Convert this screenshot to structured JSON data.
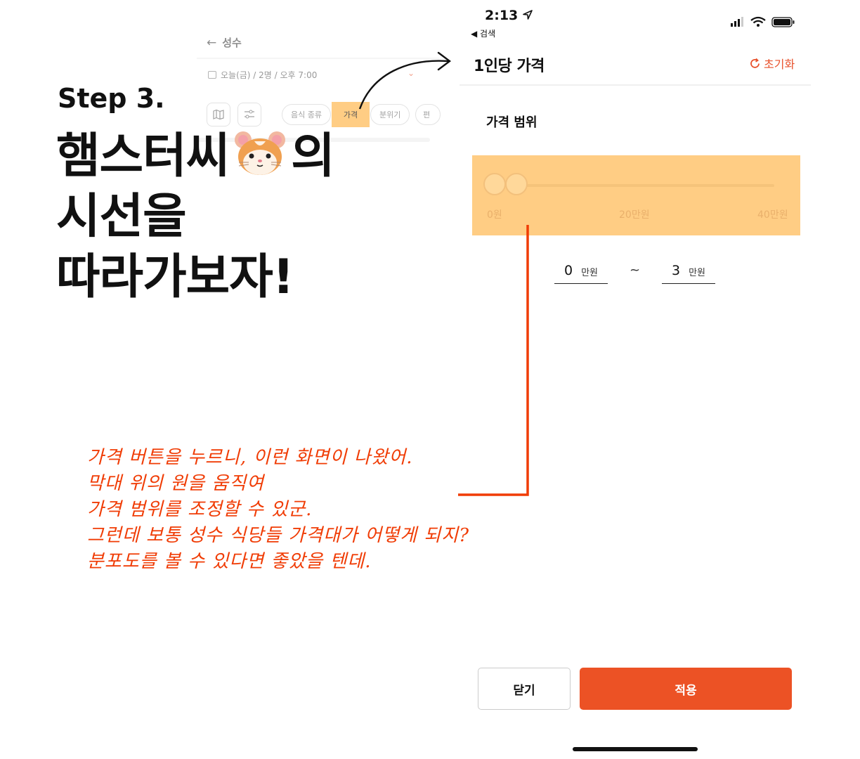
{
  "background_screen": {
    "back_title": "성수",
    "date_info": "오늘(금) / 2명 / 오후 7:00",
    "chips": [
      "음식 종류",
      "가격",
      "분위기",
      "편"
    ]
  },
  "headline": {
    "step": "Step 3.",
    "line1_before": "햄스터씨",
    "line1_after": "의",
    "line2": "시선을",
    "line3": "따라가보자!"
  },
  "status_bar": {
    "time": "2:13",
    "back_app": "◀ 검색"
  },
  "header": {
    "title": "1인당 가격",
    "reset_label": "초기화"
  },
  "price_range": {
    "label": "가격 범위",
    "ticks": [
      "0원",
      "20만원",
      "40만원"
    ],
    "min_value": "0",
    "max_value": "3",
    "unit": "만원",
    "separator": "~"
  },
  "buttons": {
    "close_label": "닫기",
    "apply_label": "적용"
  },
  "annotation": {
    "lines": [
      "가격 버튼을 누르니, 이런 화면이 나왔어.",
      "막대 위의 원을 움직여",
      "가격 범위를 조정할 수 있군.",
      "그런데 보통 성수 식당들 가격대가 어떻게 되지?",
      "분포도를 볼 수 있다면 좋았을 텐데."
    ]
  },
  "colors": {
    "accent": "#ec5225",
    "highlight": "#ffcd84",
    "annotation": "#f03c05"
  }
}
